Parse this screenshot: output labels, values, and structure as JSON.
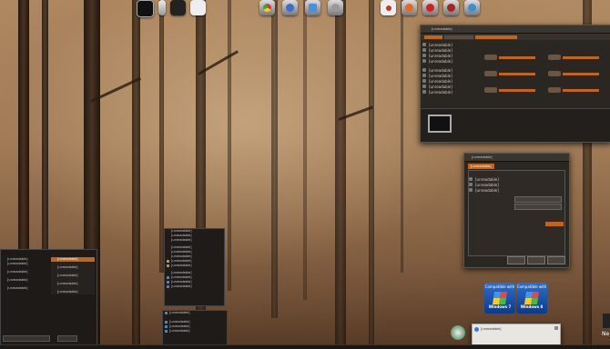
{
  "desktop": {
    "wallpaper": "foggy-autumn-forest",
    "accent": "#c2641c"
  },
  "dock": {
    "left_icons": [
      "terminal-icon",
      "usb-drive-icon",
      "film-icon",
      "notepad-icon",
      "chrome-icon",
      "thunderbird-icon",
      "network-icon",
      "mail-icon"
    ],
    "right_icons": [
      "ccleaner-icon",
      "firefox-icon",
      "red-app-icon",
      "pinball-icon",
      "shield-icon"
    ]
  },
  "explorer": {
    "title": "[unreadable]",
    "tab_active": "[unreadable]"
  },
  "properties_dialog": {
    "title": "[unreadable]",
    "tab": "[unreadable]"
  },
  "badges": [
    {
      "top": "Compatible with",
      "bottom": "Windows 7"
    },
    {
      "top": "Compatible with",
      "bottom": "Windows 8"
    }
  ],
  "notification": {
    "title": "[unreadable]"
  },
  "corner_text": "Ne"
}
